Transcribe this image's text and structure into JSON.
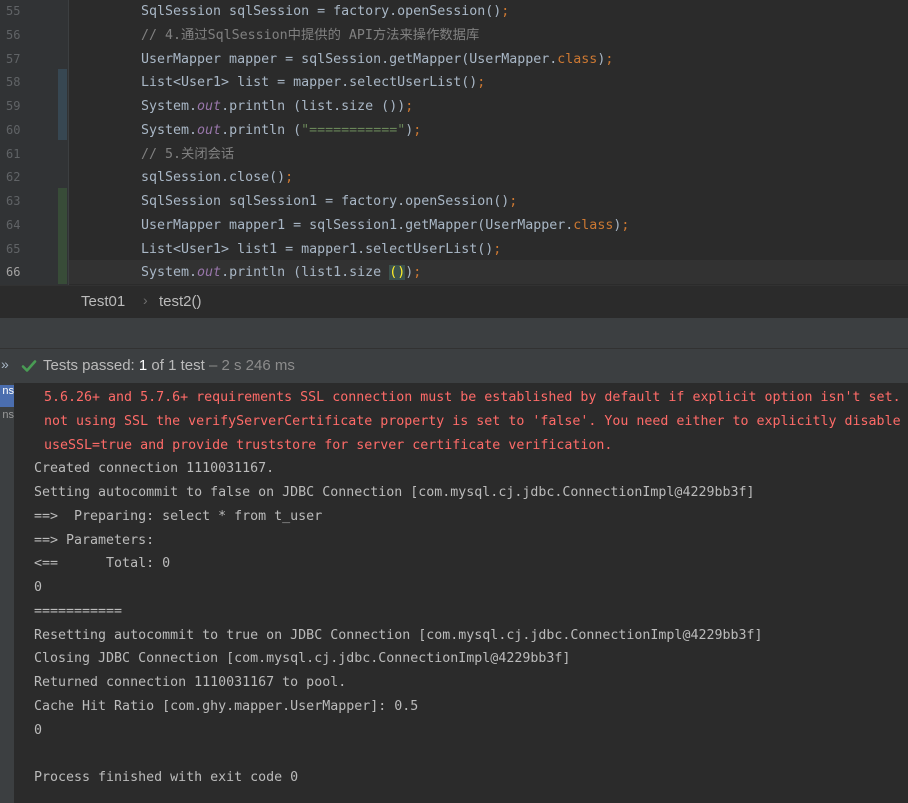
{
  "editor": {
    "lines": [
      {
        "no": "55",
        "segments": [
          {
            "t": "SqlSession sqlSession = factory.openSession()"
          },
          {
            "t": ";",
            "c": "kw"
          }
        ]
      },
      {
        "no": "56",
        "segments": [
          {
            "t": "// 4.通过SqlSession中提供的 API方法来操作数据库",
            "c": "cmt"
          }
        ]
      },
      {
        "no": "57",
        "segments": [
          {
            "t": "UserMapper mapper = sqlSession.getMapper(UserMapper."
          },
          {
            "t": "class",
            "c": "kw"
          },
          {
            "t": ")"
          },
          {
            "t": ";",
            "c": "kw"
          }
        ]
      },
      {
        "no": "58",
        "segments": [
          {
            "t": "List<User1> list = mapper.selectUserList()"
          },
          {
            "t": ";",
            "c": "kw"
          }
        ]
      },
      {
        "no": "59",
        "segments": [
          {
            "t": "System."
          },
          {
            "t": "out",
            "c": "fld"
          },
          {
            "t": ".println (list.size ())"
          },
          {
            "t": ";",
            "c": "kw"
          }
        ]
      },
      {
        "no": "60",
        "segments": [
          {
            "t": "System."
          },
          {
            "t": "out",
            "c": "fld"
          },
          {
            "t": ".println ("
          },
          {
            "t": "\"===========\"",
            "c": "str"
          },
          {
            "t": ")"
          },
          {
            "t": ";",
            "c": "kw"
          }
        ]
      },
      {
        "no": "61",
        "segments": [
          {
            "t": "// 5.关闭会话",
            "c": "cmt"
          }
        ]
      },
      {
        "no": "62",
        "segments": [
          {
            "t": "sqlSession.close()"
          },
          {
            "t": ";",
            "c": "kw"
          }
        ]
      },
      {
        "no": "63",
        "segments": [
          {
            "t": "SqlSession sqlSession1 = factory.openSession()"
          },
          {
            "t": ";",
            "c": "kw"
          }
        ]
      },
      {
        "no": "64",
        "segments": [
          {
            "t": "UserMapper mapper1 = sqlSession1.getMapper(UserMapper."
          },
          {
            "t": "class",
            "c": "kw"
          },
          {
            "t": ")"
          },
          {
            "t": ";",
            "c": "kw"
          }
        ]
      },
      {
        "no": "65",
        "segments": [
          {
            "t": "List<User1> list1 = mapper1.selectUserList()"
          },
          {
            "t": ";",
            "c": "kw"
          }
        ]
      },
      {
        "no": "66",
        "segments": [
          {
            "t": "System."
          },
          {
            "t": "out",
            "c": "fld"
          },
          {
            "t": ".println (list1.size "
          },
          {
            "t": "()",
            "c": "brk"
          },
          {
            "t": ")"
          },
          {
            "t": ";",
            "c": "kw"
          }
        ]
      }
    ]
  },
  "breadcrumb": {
    "class_name": "Test01",
    "separator": "›",
    "method_name": "test2()"
  },
  "run": {
    "chevron": "»",
    "status_label": "Tests passed: ",
    "status_count": "1",
    "status_rest": " of 1 test",
    "status_time": " – 2 s 246 ms",
    "strip_tab_1": "ns",
    "strip_tab_2": "ns"
  },
  "console": {
    "lines": [
      {
        "text": "5.6.26+ and 5.7.6+ requirements SSL connection must be established by default if explicit option isn't set.",
        "type": "err"
      },
      {
        "text": "not using SSL the verifyServerCertificate property is set to 'false'. You need either to explicitly disable",
        "type": "err"
      },
      {
        "text": "useSSL=true and provide truststore for server certificate verification.",
        "type": "err"
      },
      {
        "text": "Created connection 1110031167.",
        "type": "out"
      },
      {
        "text": "Setting autocommit to false on JDBC Connection [com.mysql.cj.jdbc.ConnectionImpl@4229bb3f]",
        "type": "out"
      },
      {
        "text": "==>  Preparing: select * from t_user",
        "type": "out"
      },
      {
        "text": "==> Parameters: ",
        "type": "out"
      },
      {
        "text": "<==      Total: 0",
        "type": "out"
      },
      {
        "text": "0",
        "type": "out"
      },
      {
        "text": "===========",
        "type": "out"
      },
      {
        "text": "Resetting autocommit to true on JDBC Connection [com.mysql.cj.jdbc.ConnectionImpl@4229bb3f]",
        "type": "out"
      },
      {
        "text": "Closing JDBC Connection [com.mysql.cj.jdbc.ConnectionImpl@4229bb3f]",
        "type": "out"
      },
      {
        "text": "Returned connection 1110031167 to pool.",
        "type": "out"
      },
      {
        "text": "Cache Hit Ratio [com.ghy.mapper.UserMapper]: 0.5",
        "type": "out"
      },
      {
        "text": "0",
        "type": "out"
      },
      {
        "text": "",
        "type": "out"
      },
      {
        "text": "Process finished with exit code 0",
        "type": "out"
      }
    ]
  },
  "colors": {
    "background": "#2b2b2b",
    "keyword": "#cc7832",
    "comment": "#808080",
    "string": "#6a8759",
    "field": "#9876aa",
    "error_text": "#ff6b68",
    "pass_check": "#499c54"
  },
  "icons": [
    "check-icon",
    "chevron-icon",
    "breadcrumb-separator-icon"
  ]
}
